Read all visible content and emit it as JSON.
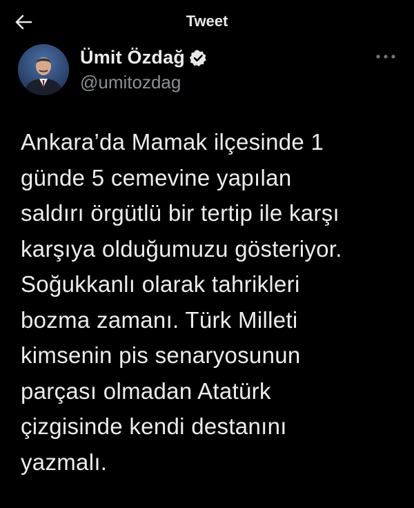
{
  "header": {
    "title": "Tweet",
    "back_icon": "arrow-left-icon"
  },
  "author": {
    "display_name": "Ümit Özdağ",
    "handle": "@umitozdag",
    "verified": true,
    "verified_color": "#e8e8e8",
    "avatar_icon": "profile-photo"
  },
  "tweet": {
    "text": "Ankara’da Mamak ilçesinde 1\ngünde 5 cemevine yapılan\nsaldırı örgütlü bir tertip ile karşı\nkarşıya olduğumuzu gösteriyor.\nSoğukkanlı olarak tahrikleri\nbozma zamanı. Türk Milleti\nkimsenin pis senaryosunun\nparçası olmadan Atatürk\nçizgisinde kendi destanını\nyazmalı."
  },
  "menu": {
    "more_icon": "more-options-icon"
  }
}
